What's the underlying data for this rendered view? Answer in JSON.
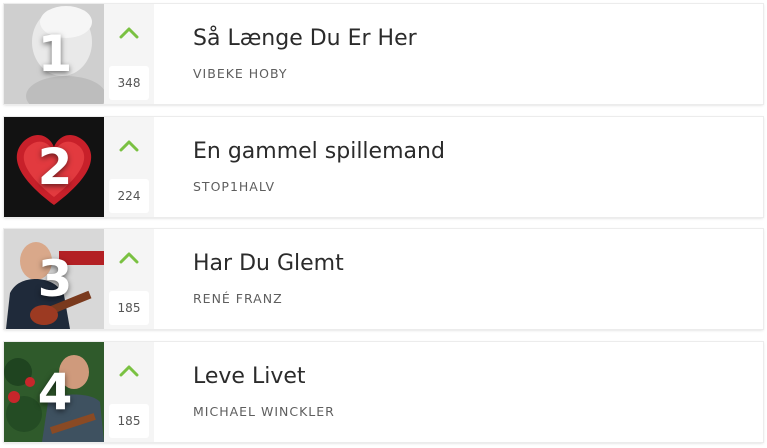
{
  "accent_color": "#7ac142",
  "entries": [
    {
      "rank": "1",
      "title": "Så Længe Du Er Her",
      "artist": "VIBEKE HOBY",
      "votes": "348",
      "vote_icon": "chevron-up-icon"
    },
    {
      "rank": "2",
      "title": "En gammel spillemand",
      "artist": "STOP1HALV",
      "votes": "224",
      "vote_icon": "chevron-up-icon"
    },
    {
      "rank": "3",
      "title": "Har Du Glemt",
      "artist": "RENÉ FRANZ",
      "votes": "185",
      "vote_icon": "chevron-up-icon"
    },
    {
      "rank": "4",
      "title": "Leve Livet",
      "artist": "MICHAEL WINCKLER",
      "votes": "185",
      "vote_icon": "chevron-up-icon"
    }
  ]
}
